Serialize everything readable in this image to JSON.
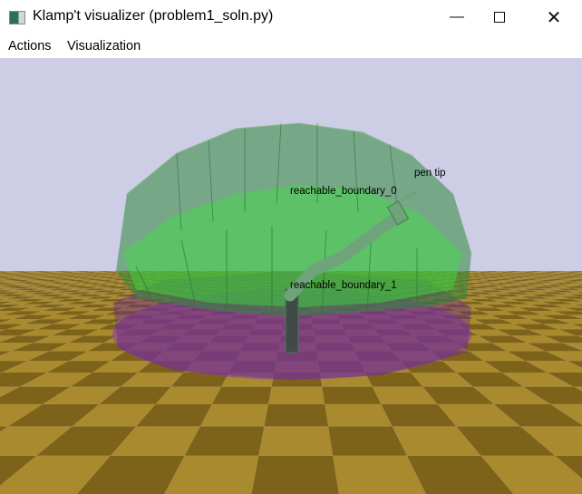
{
  "window": {
    "title": "Klamp't visualizer (problem1_soln.py)",
    "minimize_icon": "minimize-icon",
    "maximize_icon": "maximize-icon",
    "close_icon": "close-icon"
  },
  "menu": {
    "items": [
      {
        "label": "Actions"
      },
      {
        "label": "Visualization"
      }
    ]
  },
  "scene": {
    "labels": {
      "pen_tip": "pen tip",
      "boundary_0": "reachable_boundary_0",
      "boundary_1": "reachable_boundary_1"
    },
    "colors": {
      "sky": "#cdcde6",
      "floor_light": "#a98a2e",
      "floor_dark": "#7d6219",
      "dome_green": "#2f8a3a",
      "bright_green": "#3fe040",
      "purple": "#8a3aa8",
      "robot": "#6fa37a"
    }
  }
}
